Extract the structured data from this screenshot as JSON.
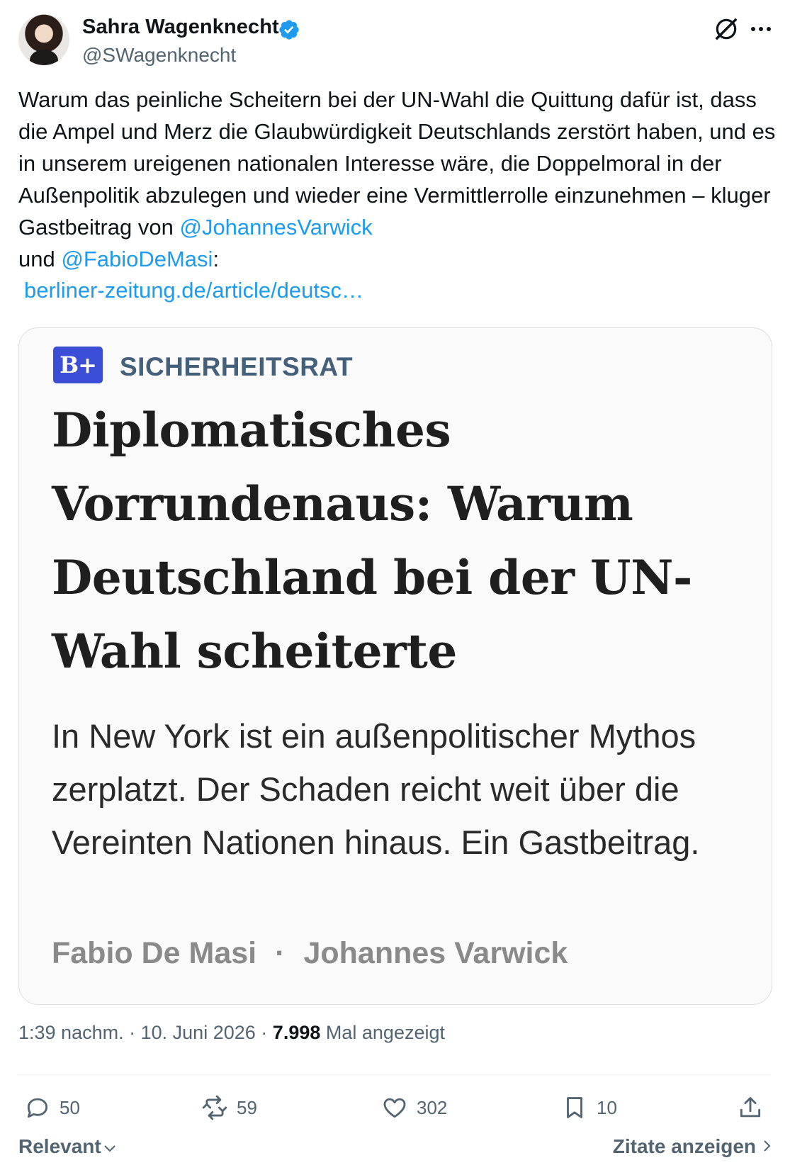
{
  "author": {
    "name": "Sahra Wagenknecht",
    "handle": "@SWagenknecht",
    "verified": true,
    "verified_color": "#1d9bf0"
  },
  "header_icons": [
    "grok-icon",
    "more-icon"
  ],
  "tweet": {
    "text_1": "Warum das peinliche Scheitern bei der UN-Wahl die Quittung dafür ist, dass die Ampel und Merz die Glaubwürdigkeit Deutschlands zerstört haben, und es in unserem ureigenen nationalen Interesse wäre, die Doppelmoral in der Außenpolitik abzulegen und wieder eine Vermittlerrolle einzunehmen – kluger Gastbeitrag von ",
    "mention_1": "@JohannesVarwick",
    "text_2": "und ",
    "mention_2": "@FabioDeMasi",
    "text_3": ":",
    "url": "berliner-zeitung.de/article/deutsc…",
    "link_color": "#1d9bf0"
  },
  "card": {
    "badge": "B+",
    "kicker": "SICHERHEITSRAT",
    "headline": "Diplomatisches Vorrundenaus: Warum Deutschland bei der UN-Wahl scheiterte",
    "teaser": "In New York ist ein außenpolitischer Mythos zerplatzt. Der Schaden reicht weit über die Vereinten Nationen hinaus. Ein Gastbeitrag.",
    "author_1": "Fabio De Masi",
    "separator": "·",
    "author_2": "Johannes Varwick"
  },
  "meta": {
    "time": "1:39 nachm.",
    "sep": "·",
    "date": "10. Juni 2026",
    "views_count": "7.998",
    "views_label": "Mal angezeigt"
  },
  "actions": {
    "replies": "50",
    "reposts": "59",
    "likes": "302",
    "bookmarks": "10"
  },
  "footer": {
    "sort_label": "Relevant",
    "quotes_label": "Zitate anzeigen"
  }
}
